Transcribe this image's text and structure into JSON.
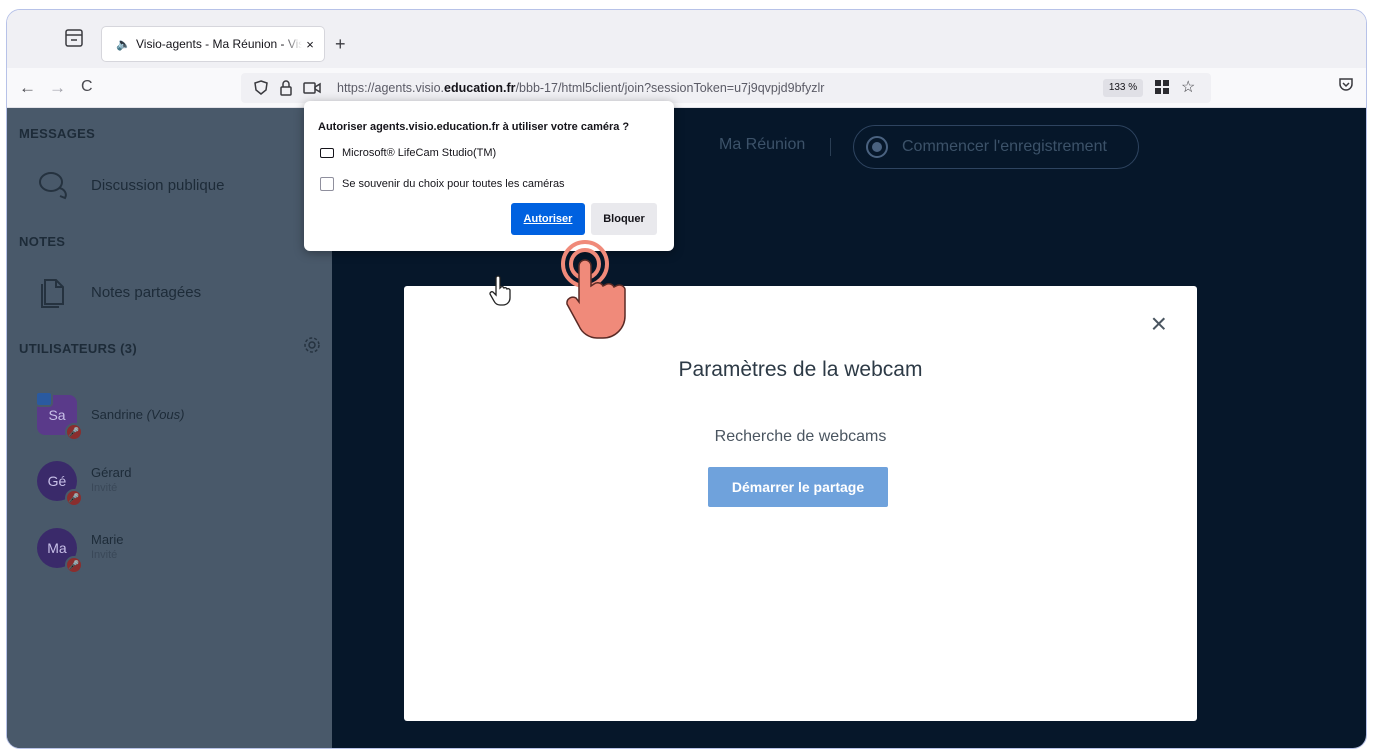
{
  "browser": {
    "tab": {
      "title": "Visio-agents - Ma Réunion - Visio-agents",
      "close": "×",
      "sound_icon": "speaker-icon"
    },
    "new_tab": "+",
    "nav": {
      "back": "←",
      "forward": "→",
      "reload": "C"
    },
    "url": {
      "prefix": "https://agents.visio.",
      "domain": "education.fr",
      "suffix": "/bbb-17/html5client/join?sessionToken=u7j9qvpjd9bfyzlr"
    },
    "zoom": "133 %"
  },
  "permission_popup": {
    "question": "Autoriser agents.visio.education.fr à utiliser votre caméra ?",
    "camera": "Microsoft® LifeCam Studio(TM)",
    "remember": "Se souvenir du choix pour toutes les caméras",
    "allow": "Autoriser",
    "block": "Bloquer"
  },
  "sidebar": {
    "messages_header": "MESSAGES",
    "public_chat": "Discussion publique",
    "notes_header": "NOTES",
    "shared_notes": "Notes partagées",
    "users_header": "UTILISATEURS (3)",
    "users": [
      {
        "initials": "Sa",
        "name": "Sandrine",
        "you": "(Vous)",
        "role": ""
      },
      {
        "initials": "Gé",
        "name": "Gérard",
        "you": "",
        "role": "Invité"
      },
      {
        "initials": "Ma",
        "name": "Marie",
        "you": "",
        "role": "Invité"
      }
    ]
  },
  "header": {
    "meeting_name": "Ma Réunion",
    "record": "Commencer l'enregistrement"
  },
  "webcam_modal": {
    "title": "Paramètres de la webcam",
    "status": "Recherche de webcams",
    "start": "Démarrer le partage",
    "close": "×"
  },
  "colors": {
    "accent": "#0061e0",
    "modal_button": "#6fa2dc",
    "app_bg": "#06172a",
    "sidebar_bg": "#49596a"
  }
}
